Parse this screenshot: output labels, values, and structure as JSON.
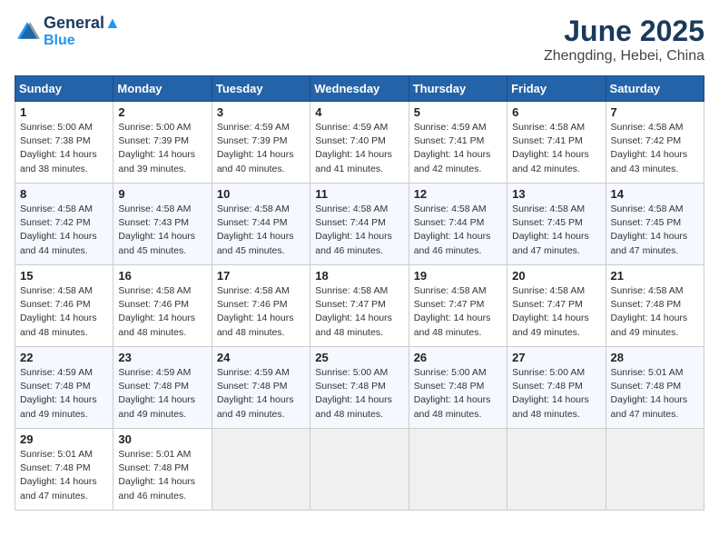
{
  "logo": {
    "line1": "General",
    "line2": "Blue"
  },
  "title": "June 2025",
  "location": "Zhengding, Hebei, China",
  "days_of_week": [
    "Sunday",
    "Monday",
    "Tuesday",
    "Wednesday",
    "Thursday",
    "Friday",
    "Saturday"
  ],
  "weeks": [
    [
      {
        "day": "1",
        "sunrise": "5:00 AM",
        "sunset": "7:38 PM",
        "daylight": "14 hours and 38 minutes."
      },
      {
        "day": "2",
        "sunrise": "5:00 AM",
        "sunset": "7:39 PM",
        "daylight": "14 hours and 39 minutes."
      },
      {
        "day": "3",
        "sunrise": "4:59 AM",
        "sunset": "7:39 PM",
        "daylight": "14 hours and 40 minutes."
      },
      {
        "day": "4",
        "sunrise": "4:59 AM",
        "sunset": "7:40 PM",
        "daylight": "14 hours and 41 minutes."
      },
      {
        "day": "5",
        "sunrise": "4:59 AM",
        "sunset": "7:41 PM",
        "daylight": "14 hours and 42 minutes."
      },
      {
        "day": "6",
        "sunrise": "4:58 AM",
        "sunset": "7:41 PM",
        "daylight": "14 hours and 42 minutes."
      },
      {
        "day": "7",
        "sunrise": "4:58 AM",
        "sunset": "7:42 PM",
        "daylight": "14 hours and 43 minutes."
      }
    ],
    [
      {
        "day": "8",
        "sunrise": "4:58 AM",
        "sunset": "7:42 PM",
        "daylight": "14 hours and 44 minutes."
      },
      {
        "day": "9",
        "sunrise": "4:58 AM",
        "sunset": "7:43 PM",
        "daylight": "14 hours and 45 minutes."
      },
      {
        "day": "10",
        "sunrise": "4:58 AM",
        "sunset": "7:44 PM",
        "daylight": "14 hours and 45 minutes."
      },
      {
        "day": "11",
        "sunrise": "4:58 AM",
        "sunset": "7:44 PM",
        "daylight": "14 hours and 46 minutes."
      },
      {
        "day": "12",
        "sunrise": "4:58 AM",
        "sunset": "7:44 PM",
        "daylight": "14 hours and 46 minutes."
      },
      {
        "day": "13",
        "sunrise": "4:58 AM",
        "sunset": "7:45 PM",
        "daylight": "14 hours and 47 minutes."
      },
      {
        "day": "14",
        "sunrise": "4:58 AM",
        "sunset": "7:45 PM",
        "daylight": "14 hours and 47 minutes."
      }
    ],
    [
      {
        "day": "15",
        "sunrise": "4:58 AM",
        "sunset": "7:46 PM",
        "daylight": "14 hours and 48 minutes."
      },
      {
        "day": "16",
        "sunrise": "4:58 AM",
        "sunset": "7:46 PM",
        "daylight": "14 hours and 48 minutes."
      },
      {
        "day": "17",
        "sunrise": "4:58 AM",
        "sunset": "7:46 PM",
        "daylight": "14 hours and 48 minutes."
      },
      {
        "day": "18",
        "sunrise": "4:58 AM",
        "sunset": "7:47 PM",
        "daylight": "14 hours and 48 minutes."
      },
      {
        "day": "19",
        "sunrise": "4:58 AM",
        "sunset": "7:47 PM",
        "daylight": "14 hours and 48 minutes."
      },
      {
        "day": "20",
        "sunrise": "4:58 AM",
        "sunset": "7:47 PM",
        "daylight": "14 hours and 49 minutes."
      },
      {
        "day": "21",
        "sunrise": "4:58 AM",
        "sunset": "7:48 PM",
        "daylight": "14 hours and 49 minutes."
      }
    ],
    [
      {
        "day": "22",
        "sunrise": "4:59 AM",
        "sunset": "7:48 PM",
        "daylight": "14 hours and 49 minutes."
      },
      {
        "day": "23",
        "sunrise": "4:59 AM",
        "sunset": "7:48 PM",
        "daylight": "14 hours and 49 minutes."
      },
      {
        "day": "24",
        "sunrise": "4:59 AM",
        "sunset": "7:48 PM",
        "daylight": "14 hours and 49 minutes."
      },
      {
        "day": "25",
        "sunrise": "5:00 AM",
        "sunset": "7:48 PM",
        "daylight": "14 hours and 48 minutes."
      },
      {
        "day": "26",
        "sunrise": "5:00 AM",
        "sunset": "7:48 PM",
        "daylight": "14 hours and 48 minutes."
      },
      {
        "day": "27",
        "sunrise": "5:00 AM",
        "sunset": "7:48 PM",
        "daylight": "14 hours and 48 minutes."
      },
      {
        "day": "28",
        "sunrise": "5:01 AM",
        "sunset": "7:48 PM",
        "daylight": "14 hours and 47 minutes."
      }
    ],
    [
      {
        "day": "29",
        "sunrise": "5:01 AM",
        "sunset": "7:48 PM",
        "daylight": "14 hours and 47 minutes."
      },
      {
        "day": "30",
        "sunrise": "5:01 AM",
        "sunset": "7:48 PM",
        "daylight": "14 hours and 46 minutes."
      },
      null,
      null,
      null,
      null,
      null
    ]
  ]
}
